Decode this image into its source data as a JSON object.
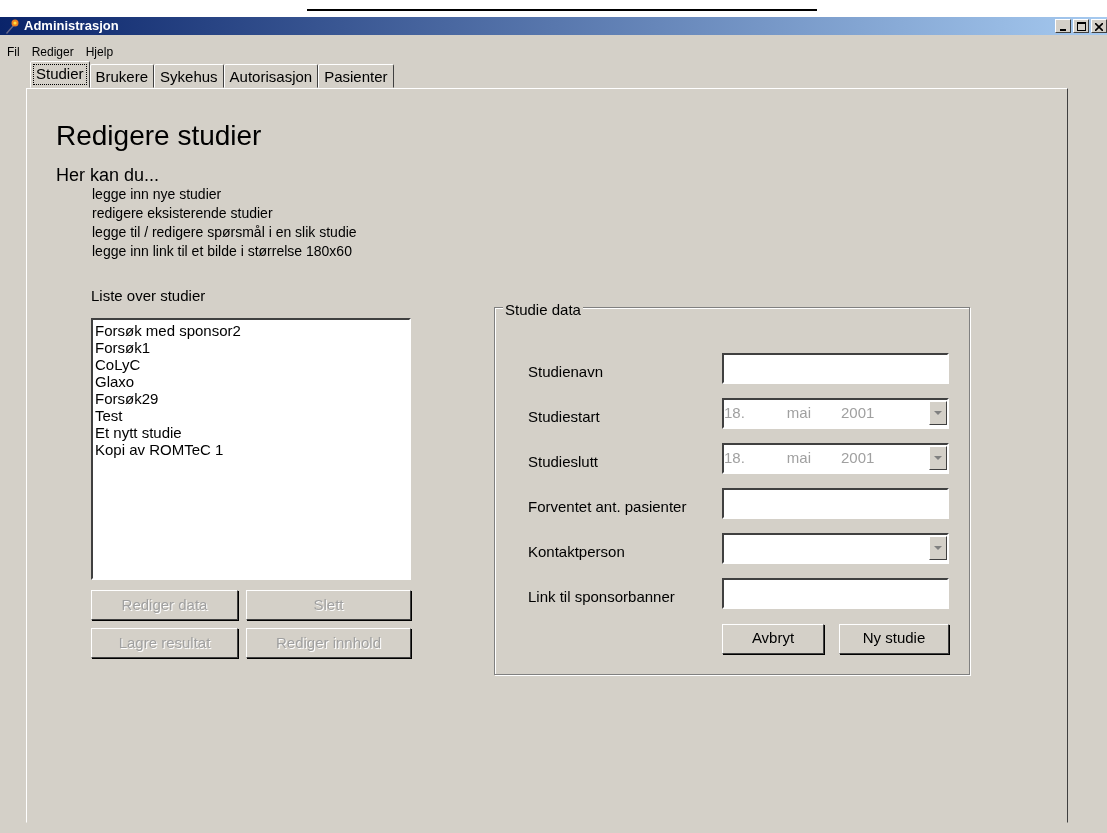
{
  "window": {
    "title": "Administrasjon"
  },
  "menu": [
    "Fil",
    "Rediger",
    "Hjelp"
  ],
  "tabs": [
    {
      "label": "Studier",
      "selected": true
    },
    {
      "label": "Brukere",
      "selected": false
    },
    {
      "label": "Sykehus",
      "selected": false
    },
    {
      "label": "Autorisasjon",
      "selected": false
    },
    {
      "label": "Pasienter",
      "selected": false
    }
  ],
  "heading": "Redigere studier",
  "intro": {
    "lead": "Her kan du...",
    "items": [
      "legge inn nye studier",
      "redigere eksisterende studier",
      "legge til / redigere spørsmål i en slik studie",
      "legge inn link til et bilde i størrelse 180x60"
    ]
  },
  "study_list": {
    "label": "Liste over studier",
    "items": [
      {
        "text": "Forsøk med sponsor2",
        "selected": false
      },
      {
        "text": "Forsøk1",
        "selected": false
      },
      {
        "text": "CoLyC",
        "selected": false
      },
      {
        "text": "Glaxo",
        "selected": false
      },
      {
        "text": "Forsøk29",
        "selected": false
      },
      {
        "text": "Test",
        "selected": false
      },
      {
        "text": "Et nytt studie",
        "selected": false
      },
      {
        "text": "Kopi av ROMTeC 1",
        "selected": false
      }
    ],
    "buttons": [
      {
        "label": "Rediger data",
        "disabled": true
      },
      {
        "label": "Slett",
        "disabled": true
      },
      {
        "label": "Lagre resultat",
        "disabled": true
      },
      {
        "label": "Rediger innhold",
        "disabled": true
      }
    ]
  },
  "study_data": {
    "title": "Studie data",
    "fields": [
      {
        "label": "Studienavn",
        "kind": "text"
      },
      {
        "label": "Studiestart",
        "kind": "date",
        "disabled": true,
        "day": "18.",
        "month": "mai",
        "year": "2001"
      },
      {
        "label": "Studieslutt",
        "kind": "date",
        "disabled": true,
        "day": "18.",
        "month": "mai",
        "year": "2001"
      },
      {
        "label": "Forventet ant. pasienter",
        "kind": "text"
      },
      {
        "label": "Kontaktperson",
        "kind": "combo"
      },
      {
        "label": "Link til sponsorbanner",
        "kind": "text"
      }
    ],
    "buttons": [
      {
        "label": "Avbryt",
        "disabled": false
      },
      {
        "label": "Ny studie",
        "disabled": false
      }
    ]
  }
}
